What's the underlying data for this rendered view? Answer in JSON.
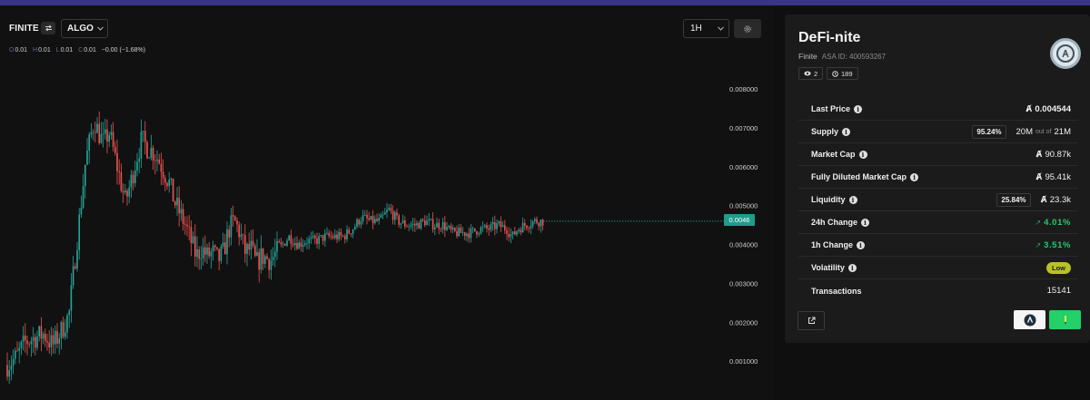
{
  "toolbar": {
    "symbol": "FINITE",
    "pair": "ALGO",
    "interval": "1H"
  },
  "ohlc": {
    "o_label": "O",
    "o": "0.01",
    "h_label": "H",
    "h": "0.01",
    "l_label": "L",
    "l": "0.01",
    "c_label": "C",
    "c": "0.01",
    "change": "−0.00 (−1.68%)"
  },
  "chart": {
    "last_price_tag": "0.0046",
    "colors": {
      "up": "#26a69a",
      "down": "#ef5350",
      "price_line": "#26a69a"
    }
  },
  "chart_data": {
    "type": "candlestick",
    "y_ticks": [
      "0.008000",
      "0.007000",
      "0.006000",
      "0.005000",
      "0.004000",
      "0.003000",
      "0.002000",
      "0.001000"
    ],
    "ylim": [
      0.0,
      0.0084
    ],
    "last_price": 0.0046,
    "close_path": [
      [
        0,
        0.0009
      ],
      [
        10,
        0.0011
      ],
      [
        20,
        0.0015
      ],
      [
        30,
        0.0016
      ],
      [
        40,
        0.0017
      ],
      [
        50,
        0.0014
      ],
      [
        60,
        0.0018
      ],
      [
        68,
        0.0022
      ],
      [
        74,
        0.0035
      ],
      [
        80,
        0.0048
      ],
      [
        86,
        0.0061
      ],
      [
        92,
        0.0068
      ],
      [
        96,
        0.0072
      ],
      [
        100,
        0.0069
      ],
      [
        106,
        0.0066
      ],
      [
        112,
        0.0069
      ],
      [
        118,
        0.0063
      ],
      [
        124,
        0.0057
      ],
      [
        130,
        0.0051
      ],
      [
        136,
        0.0056
      ],
      [
        142,
        0.0062
      ],
      [
        148,
        0.0067
      ],
      [
        154,
        0.0065
      ],
      [
        160,
        0.0064
      ],
      [
        166,
        0.0062
      ],
      [
        172,
        0.0059
      ],
      [
        178,
        0.0056
      ],
      [
        184,
        0.0051
      ],
      [
        190,
        0.0048
      ],
      [
        196,
        0.0045
      ],
      [
        202,
        0.0041
      ],
      [
        208,
        0.0037
      ],
      [
        214,
        0.0039
      ],
      [
        220,
        0.0037
      ],
      [
        226,
        0.0038
      ],
      [
        232,
        0.0036
      ],
      [
        238,
        0.0038
      ],
      [
        244,
        0.0044
      ],
      [
        250,
        0.0046
      ],
      [
        256,
        0.0043
      ],
      [
        262,
        0.0038
      ],
      [
        268,
        0.0039
      ],
      [
        274,
        0.0035
      ],
      [
        280,
        0.0037
      ],
      [
        290,
        0.0036
      ],
      [
        300,
        0.0039
      ],
      [
        310,
        0.0042
      ],
      [
        320,
        0.004
      ],
      [
        330,
        0.0041
      ],
      [
        340,
        0.0041
      ],
      [
        350,
        0.0042
      ],
      [
        360,
        0.0042
      ],
      [
        370,
        0.0042
      ],
      [
        380,
        0.0044
      ],
      [
        390,
        0.0047
      ],
      [
        400,
        0.0046
      ],
      [
        410,
        0.0046
      ],
      [
        420,
        0.0049
      ],
      [
        430,
        0.0046
      ],
      [
        440,
        0.0045
      ],
      [
        450,
        0.0045
      ],
      [
        460,
        0.0046
      ],
      [
        470,
        0.0045
      ],
      [
        480,
        0.0045
      ],
      [
        490,
        0.0043
      ],
      [
        500,
        0.0043
      ],
      [
        510,
        0.0043
      ],
      [
        520,
        0.0044
      ],
      [
        530,
        0.0044
      ],
      [
        540,
        0.0045
      ],
      [
        550,
        0.0044
      ],
      [
        556,
        0.0042
      ],
      [
        562,
        0.0044
      ],
      [
        570,
        0.0045
      ],
      [
        580,
        0.0046
      ],
      [
        590,
        0.0046
      ]
    ]
  },
  "token": {
    "name": "DeFi-nite",
    "unit": "Finite",
    "asa_id": "ASA ID: 400593267",
    "watchers": "2",
    "views": "189"
  },
  "stats": {
    "last_price_label": "Last Price",
    "last_price_value": "0.004544",
    "supply_label": "Supply",
    "supply_pct": "95.24%",
    "supply_value": "20M",
    "supply_outof": "out of",
    "supply_total": "21M",
    "market_cap_label": "Market Cap",
    "market_cap_value": "90.87k",
    "fdmc_label": "Fully Diluted Market Cap",
    "fdmc_value": "95.41k",
    "liquidity_label": "Liquidity",
    "liquidity_pct": "25.84%",
    "liquidity_value": "23.3k",
    "change24_label": "24h Change",
    "change24_value": "4.01%",
    "change1_label": "1h Change",
    "change1_value": "3.51%",
    "volatility_label": "Volatility",
    "volatility_value": "Low",
    "transactions_label": "Transactions",
    "transactions_value": "15141"
  }
}
